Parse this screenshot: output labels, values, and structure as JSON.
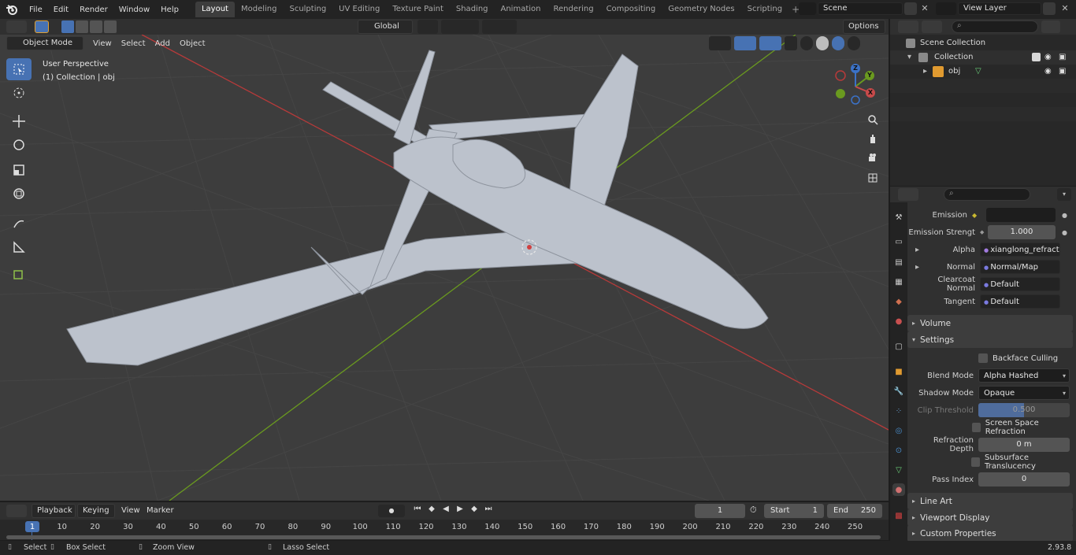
{
  "menu": {
    "file": "File",
    "edit": "Edit",
    "render": "Render",
    "window": "Window",
    "help": "Help"
  },
  "workspaces": [
    "Layout",
    "Modeling",
    "Sculpting",
    "UV Editing",
    "Texture Paint",
    "Shading",
    "Animation",
    "Rendering",
    "Compositing",
    "Geometry Nodes",
    "Scripting"
  ],
  "scene": {
    "name": "Scene",
    "view_layer": "View Layer"
  },
  "viewport_header": {
    "mode": "Object Mode",
    "view": "View",
    "select": "Select",
    "add": "Add",
    "object": "Object",
    "orientation": "Global",
    "options": "Options"
  },
  "viewport": {
    "perspective": "User Perspective",
    "collection_info": "(1) Collection | obj",
    "axis_x": "X",
    "axis_y": "Y",
    "axis_z": "Z"
  },
  "outliner": {
    "scene_collection": "Scene Collection",
    "collection": "Collection",
    "object": "obj"
  },
  "properties": {
    "emission_label": "Emission",
    "emission_strength_label": "Emission Strengt",
    "emission_strength": "1.000",
    "alpha_label": "Alpha",
    "alpha_value": "xianglong_refraction...",
    "normal_label": "Normal",
    "normal_value": "Normal/Map",
    "clearcoat_label": "Clearcoat Normal",
    "clearcoat_value": "Default",
    "tangent_label": "Tangent",
    "tangent_value": "Default",
    "volume": "Volume",
    "settings": "Settings",
    "backface": "Backface Culling",
    "blend_label": "Blend Mode",
    "blend_value": "Alpha Hashed",
    "shadow_label": "Shadow Mode",
    "shadow_value": "Opaque",
    "clip_label": "Clip Threshold",
    "clip_value": "0.500",
    "ssr": "Screen Space Refraction",
    "refraction_label": "Refraction Depth",
    "refraction_value": "0 m",
    "subsurface": "Subsurface Translucency",
    "pass_label": "Pass Index",
    "pass_value": "0",
    "line_art": "Line Art",
    "viewport_display": "Viewport Display",
    "custom_props": "Custom Properties"
  },
  "timeline": {
    "playback": "Playback",
    "keying": "Keying",
    "view": "View",
    "marker": "Marker",
    "current_frame": "1",
    "start_label": "Start",
    "start": "1",
    "end_label": "End",
    "end": "250",
    "ticks": [
      "1",
      "10",
      "20",
      "30",
      "40",
      "50",
      "60",
      "70",
      "80",
      "90",
      "100",
      "110",
      "120",
      "130",
      "140",
      "150",
      "160",
      "170",
      "180",
      "190",
      "200",
      "210",
      "220",
      "230",
      "240",
      "250"
    ]
  },
  "status": {
    "select": "Select",
    "box_select": "Box Select",
    "zoom_view": "Zoom View",
    "lasso_select": "Lasso Select",
    "version": "2.93.8"
  },
  "colors": {
    "accent": "#4772b3",
    "axis_red": "#b83a3a",
    "axis_green": "#6a9a1f",
    "header": "#303030",
    "panel": "#303030"
  }
}
